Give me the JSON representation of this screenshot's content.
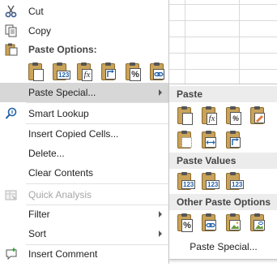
{
  "menu": {
    "cut": "Cut",
    "copy": "Copy",
    "paste_options_header": "Paste Options:",
    "paste_options_buttons": [
      {
        "name": "paste-icon",
        "text": ""
      },
      {
        "name": "paste-values-icon",
        "text": "123"
      },
      {
        "name": "paste-formulas-icon",
        "text": "fx"
      },
      {
        "name": "paste-transpose-icon",
        "text": ""
      },
      {
        "name": "paste-formatting-icon",
        "text": "%"
      },
      {
        "name": "paste-link-icon",
        "text": ""
      }
    ],
    "paste_special": "Paste Special...",
    "smart_lookup": "Smart Lookup",
    "insert_copied_cells": "Insert Copied Cells...",
    "delete": "Delete...",
    "clear_contents": "Clear Contents",
    "quick_analysis": "Quick Analysis",
    "filter": "Filter",
    "sort": "Sort",
    "insert_comment": "Insert Comment"
  },
  "submenu": {
    "paste_header": "Paste",
    "paste_values_header": "Paste Values",
    "other_header": "Other Paste Options",
    "paste_special": "Paste Special...",
    "paste_value_text": "123",
    "formula_text": "fx"
  },
  "colors": {
    "highlight": "#d7d7d7",
    "clipboard": "#c9a35a",
    "value_blue": "#1f5fa8",
    "cut_icon": "#3c5a8c"
  }
}
